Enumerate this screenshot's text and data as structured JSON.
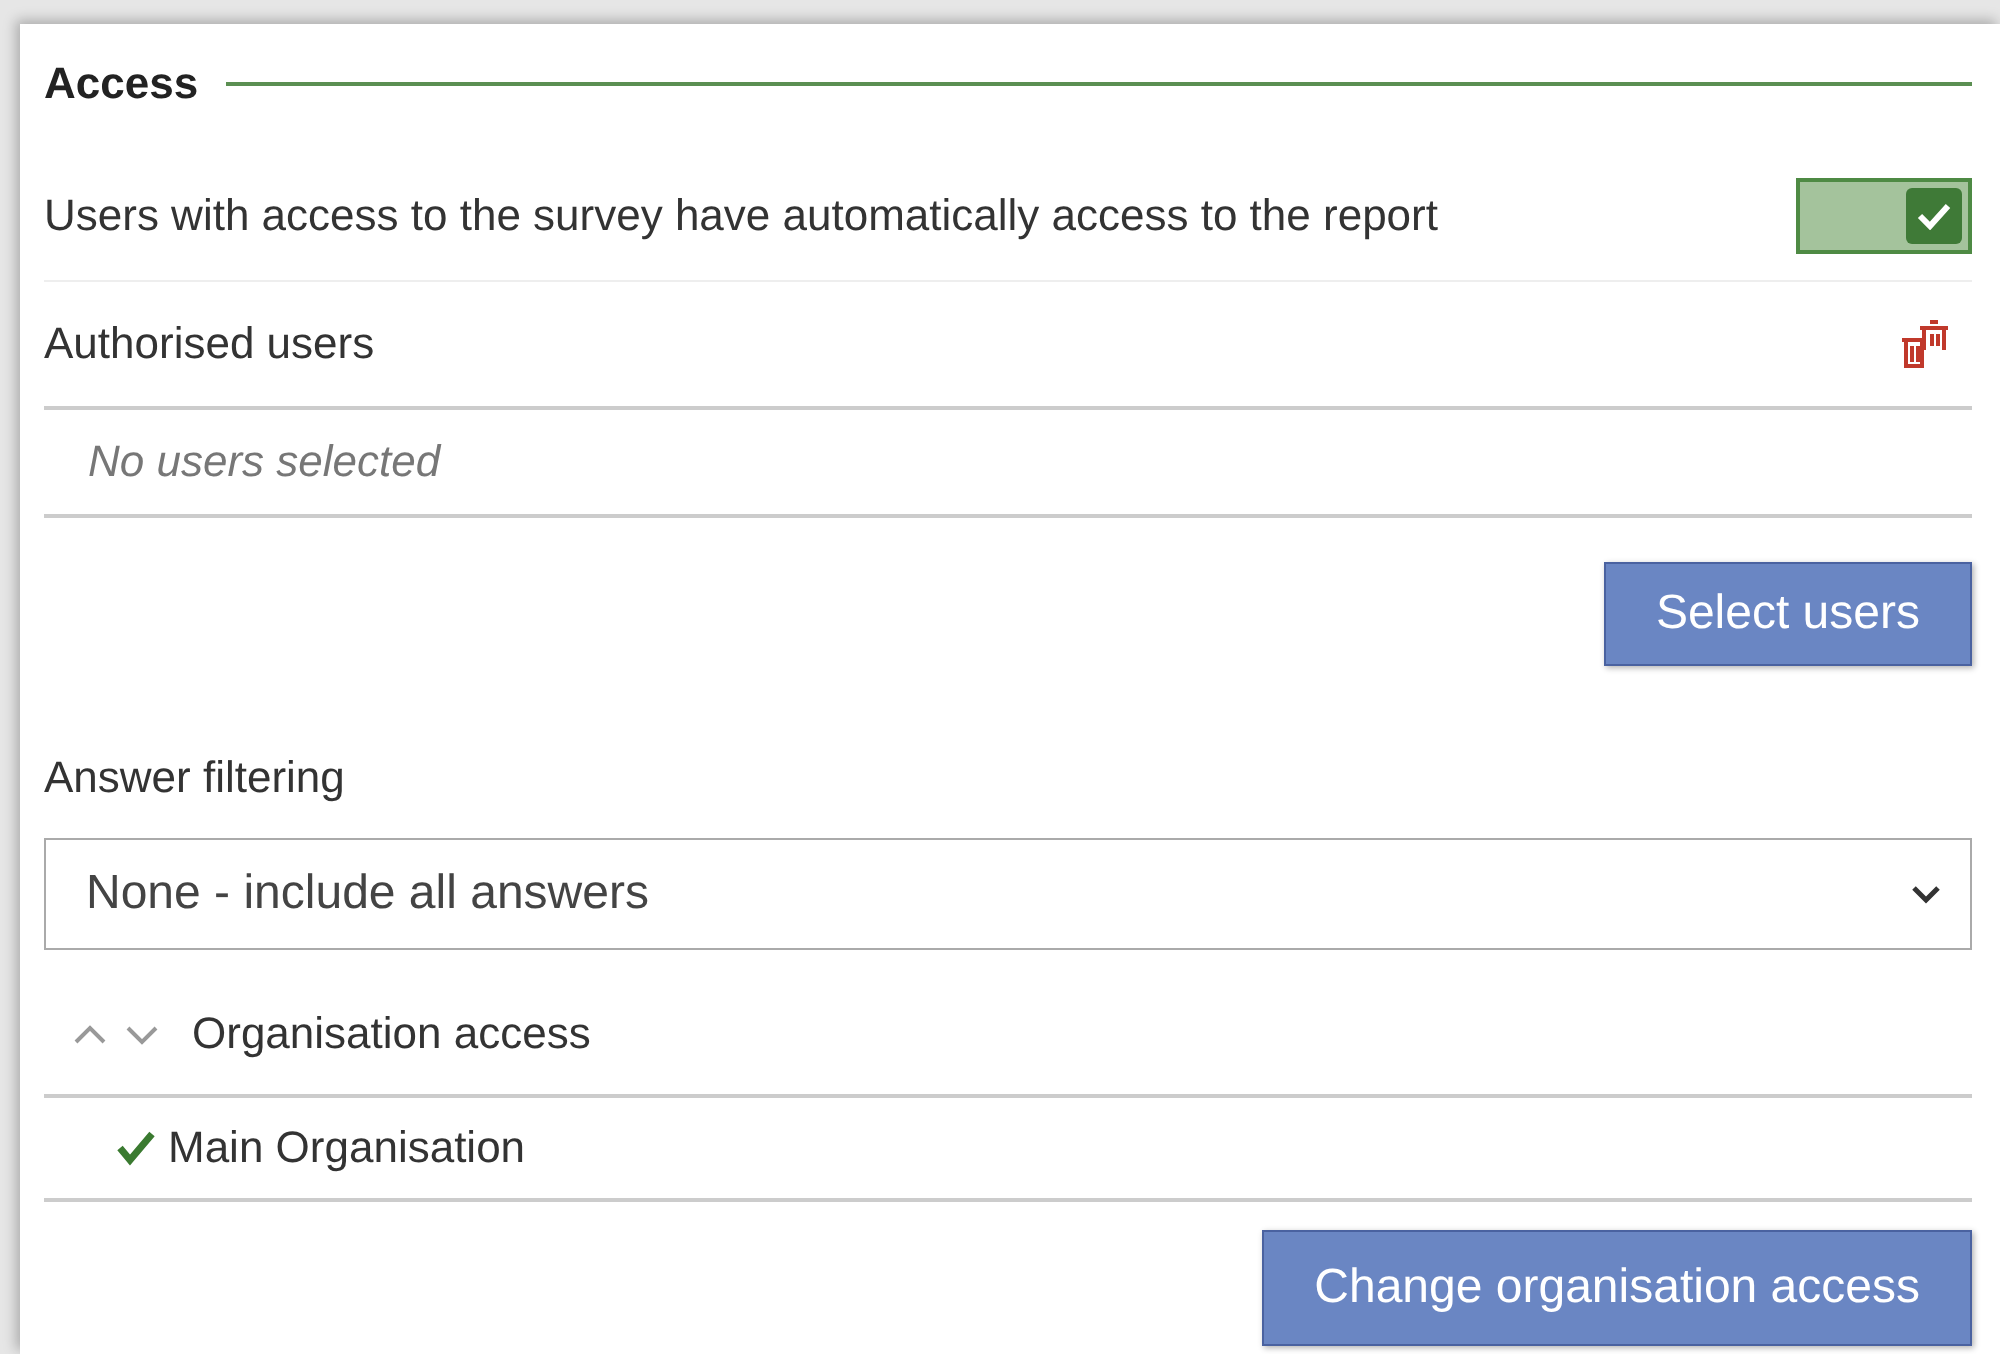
{
  "section": {
    "title": "Access"
  },
  "auto_access": {
    "label": "Users with access to the survey have automatically access to the report",
    "on": true
  },
  "authorised_users": {
    "label": "Authorised users",
    "empty_text": "No users selected",
    "button": "Select users"
  },
  "answer_filtering": {
    "label": "Answer filtering",
    "value": "None - include all answers"
  },
  "organisation_access": {
    "label": "Organisation access",
    "items": [
      {
        "name": "Main Organisation",
        "checked": true
      }
    ],
    "button": "Change organisation access"
  }
}
